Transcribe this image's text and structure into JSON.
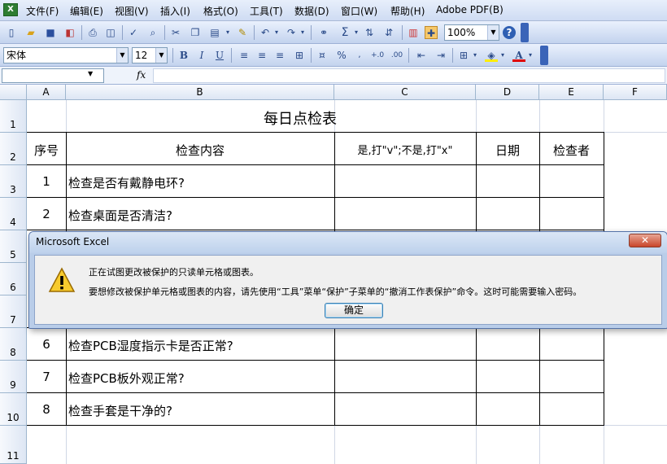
{
  "menubar": {
    "items": [
      "文件(F)",
      "编辑(E)",
      "视图(V)",
      "插入(I)",
      "格式(O)",
      "工具(T)",
      "数据(D)",
      "窗口(W)",
      "帮助(H)",
      "Adobe PDF(B)"
    ]
  },
  "toolbar": {
    "zoom": "100%",
    "font_name": "宋体",
    "font_size": "12"
  },
  "formula_bar": {
    "name_box": "",
    "fx_label": "fx",
    "formula": ""
  },
  "sheet": {
    "columns": [
      "A",
      "B",
      "C",
      "D",
      "E",
      "F"
    ],
    "rows": [
      "1",
      "2",
      "3",
      "4",
      "5",
      "6",
      "7",
      "8",
      "9",
      "10",
      "11"
    ],
    "title": "每日点检表",
    "headers": [
      "序号",
      "检查内容",
      "是,打\"v\";不是,打\"x\"",
      "日期",
      "检查者"
    ],
    "body_rows": [
      {
        "no": "1",
        "item": "检查是否有戴静电环?"
      },
      {
        "no": "2",
        "item": "检查桌面是否清洁?"
      },
      {
        "no": "",
        "item": ""
      },
      {
        "no": "",
        "item": ""
      },
      {
        "no": "",
        "item": ""
      },
      {
        "no": "6",
        "item": "检查PCB湿度指示卡是否正常?"
      },
      {
        "no": "7",
        "item": "检查PCB板外观正常?"
      },
      {
        "no": "8",
        "item": "检查手套是干净的?"
      }
    ]
  },
  "dialog": {
    "title": "Microsoft Excel",
    "message_line1": "正在试图更改被保护的只读单元格或图表。",
    "message_line2": "要想修改被保护单元格或图表的内容，请先使用“工具”菜单“保护”子菜单的“撤消工作表保护”命令。这时可能需要输入密码。",
    "ok_label": "确定",
    "close_label": "✕"
  },
  "colors": {
    "menubar_bg": "#dbe5f5",
    "dialog_frame": "#b9cde9",
    "close_button": "#c9452a"
  }
}
